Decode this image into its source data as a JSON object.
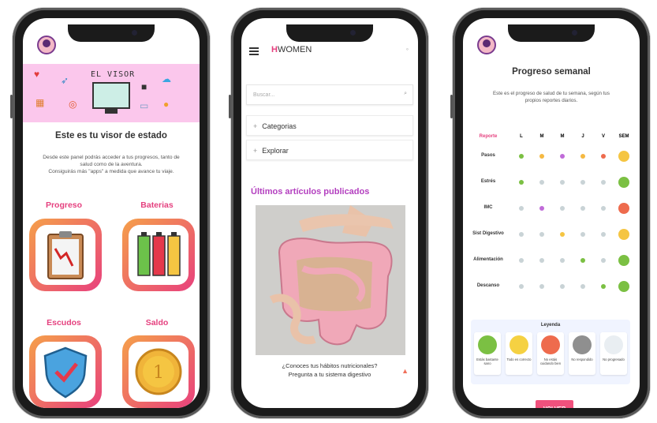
{
  "phone1": {
    "banner_title": "EL VISOR",
    "heading": "Este es tu visor de estado",
    "desc_line1": "Desde este panel podrás acceder a tus progresos, tanto de",
    "desc_line2": "salud como de la aventura.",
    "desc_line3": "Consiguirás más \"apps\" a medida que avance tu viaje.",
    "cards": [
      "Progreso",
      "Baterias",
      "Escudos",
      "Saldo"
    ]
  },
  "phone2": {
    "logo_mark": "H",
    "logo_text": "WOMEN",
    "search_placeholder": "Buscar...",
    "accordion": [
      "Categorias",
      "Explorar"
    ],
    "articles_title": "Últimos artículos publicados",
    "caption_line1": "¿Conoces tus hábitos nutricionales?",
    "caption_line2": "Pregunta a tu sistema digestivo"
  },
  "phone3": {
    "title": "Progreso semanal",
    "subtitle_line1": "Este es el progreso de salud de tu semana, según tus",
    "subtitle_line2": "propios reportes diarios.",
    "headers": [
      "Reporte",
      "L",
      "M",
      "M",
      "J",
      "V",
      "SEM"
    ],
    "rows": [
      {
        "label": "Pasos",
        "dots": [
          "#7bc043",
          "#f5b942",
          "#c06bd8",
          "#f5b942",
          "#ee6b4d"
        ],
        "week": "#f5c542"
      },
      {
        "label": "Estrés",
        "dots": [
          "#7bc043",
          "#c9d3d6",
          "#c9d3d6",
          "#c9d3d6",
          "#c9d3d6"
        ],
        "week": "#7bc043"
      },
      {
        "label": "IMC",
        "dots": [
          "#c9d3d6",
          "#c06bd8",
          "#c9d3d6",
          "#c9d3d6",
          "#c9d3d6"
        ],
        "week": "#ee6b4d"
      },
      {
        "label": "Sist Digestivo",
        "dots": [
          "#c9d3d6",
          "#c9d3d6",
          "#f5c542",
          "#c9d3d6",
          "#c9d3d6"
        ],
        "week": "#f5c542"
      },
      {
        "label": "Alimentación",
        "dots": [
          "#c9d3d6",
          "#c9d3d6",
          "#c9d3d6",
          "#7bc043",
          "#c9d3d6"
        ],
        "week": "#7bc043"
      },
      {
        "label": "Descanso",
        "dots": [
          "#c9d3d6",
          "#c9d3d6",
          "#c9d3d6",
          "#c9d3d6",
          "#7bc043"
        ],
        "week": "#7bc043"
      }
    ],
    "legend_title": "Leyenda",
    "legend": [
      {
        "text": "Estás bastante sano",
        "color": "#7bc043"
      },
      {
        "text": "Todo es correcto",
        "color": "#f5d142"
      },
      {
        "text": "No estás cuidando bien",
        "color": "#ee6b4d"
      },
      {
        "text": "No respondido",
        "color": "#8f8f8f"
      },
      {
        "text": "No progresado",
        "color": "#e9eef2"
      }
    ],
    "button": "VOLVER"
  }
}
